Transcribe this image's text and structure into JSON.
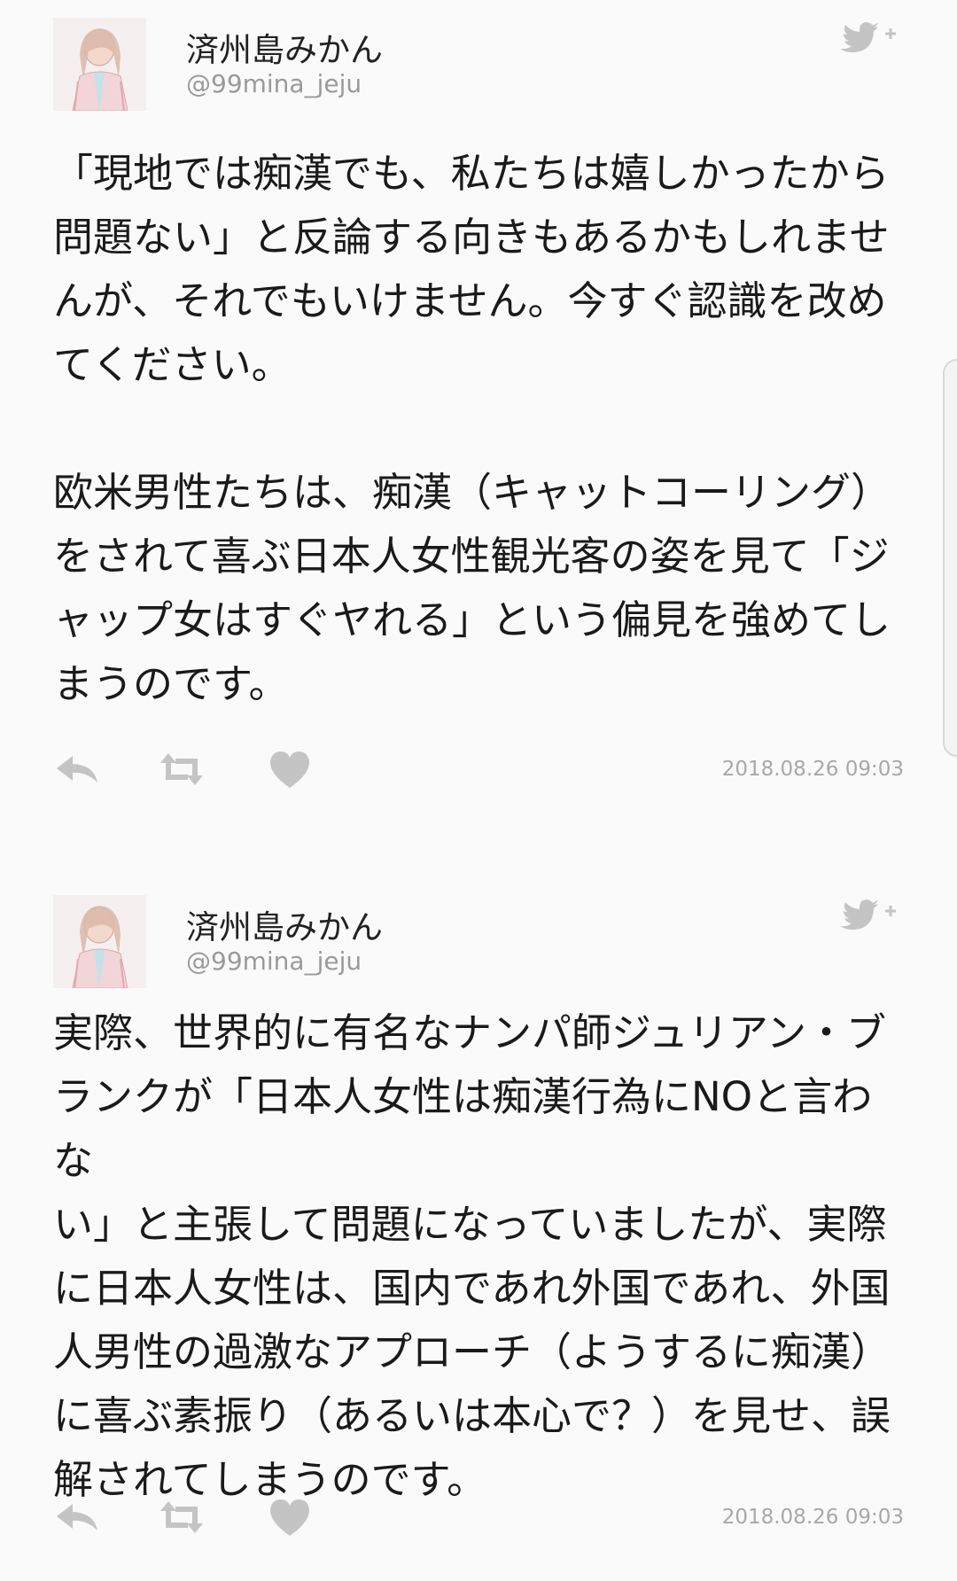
{
  "colors": {
    "background": "#fafafa",
    "text": "#1a1a1a",
    "handle": "#9a9a9a",
    "icon": "#c4c4c4"
  },
  "tweets": [
    {
      "display_name": "済州島みかん",
      "handle": "@99mina_jeju",
      "paragraphs": [
        "「現地では痴漢でも、私たちは嬉しかったから\n問題ない」と反論する向きもあるかもしれませ\nんが、それでもいけません。今すぐ認識を改め\nてください。",
        "欧米男性たちは、痴漢（キャットコーリング）\nをされて喜ぶ日本人女性観光客の姿を見て「ジ\nャップ女はすぐヤれる」という偏見を強めてし\nまうのです。"
      ],
      "timestamp": "2018.08.26 09:03",
      "icons": [
        "twitter-follow-icon",
        "reply-icon",
        "retweet-icon",
        "heart-icon"
      ]
    },
    {
      "display_name": "済州島みかん",
      "handle": "@99mina_jeju",
      "paragraphs": [
        "実際、世界的に有名なナンパ師ジュリアン・ブ\nランクが「日本人女性は痴漢行為にNOと言わな\nい」と主張して問題になっていましたが、実際\nに日本人女性は、国内であれ外国であれ、外国\n人男性の過激なアプローチ（ようするに痴漢）\nに喜ぶ素振り（あるいは本心で？）を見せ、誤\n解されてしまうのです。"
      ],
      "timestamp": "2018.08.26 09:03",
      "icons": [
        "twitter-follow-icon",
        "reply-icon",
        "retweet-icon",
        "heart-icon"
      ]
    }
  ]
}
